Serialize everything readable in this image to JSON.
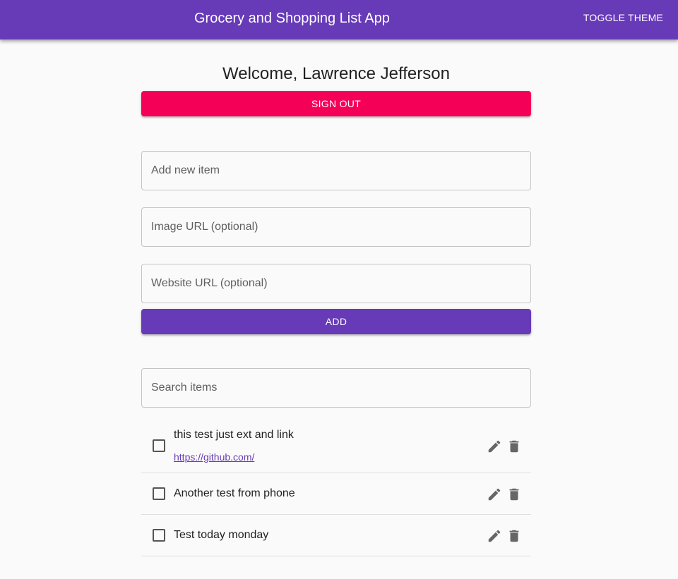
{
  "appbar": {
    "title": "Grocery and Shopping List App",
    "toggle_theme_label": "TOGGLE THEME"
  },
  "welcome": "Welcome, Lawrence Jefferson",
  "sign_out_label": "SIGN OUT",
  "form": {
    "item_placeholder": "Add new item",
    "item_value": "",
    "image_url_placeholder": "Image URL (optional)",
    "image_url_value": "",
    "website_url_placeholder": "Website URL (optional)",
    "website_url_value": "",
    "add_label": "ADD"
  },
  "search": {
    "placeholder": "Search items",
    "value": ""
  },
  "items": [
    {
      "text": "this test just ext and link",
      "link": "https://github.com/",
      "checked": false
    },
    {
      "text": "Another test from phone",
      "checked": false
    },
    {
      "text": "Test today monday",
      "checked": false
    }
  ],
  "icons": {
    "edit": "pencil-icon",
    "delete": "trash-icon"
  },
  "colors": {
    "primary": "#673ab7",
    "secondary": "#f50057",
    "background": "#fafafa"
  }
}
